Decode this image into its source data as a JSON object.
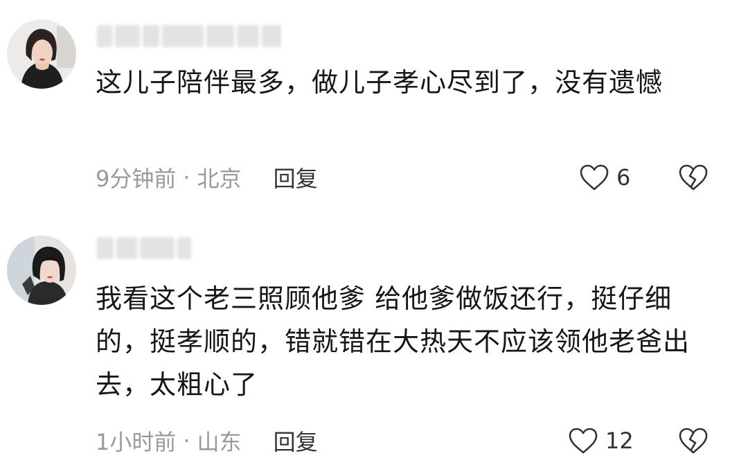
{
  "comments": [
    {
      "text": "这儿子陪伴最多，做儿子孝心尽到了，没有遗憾",
      "time": "9分钟前",
      "separator": "·",
      "location": "北京",
      "reply_label": "回复",
      "likes": "6",
      "icons": {
        "like": "heart-outline-icon",
        "dislike": "broken-heart-icon"
      }
    },
    {
      "text": "我看这个老三照顾他爹 给他爹做饭还行，挺仔细的，挺孝顺的，错就错在大热天不应该领他老爸出去，太粗心了",
      "time": "1小时前",
      "separator": "·",
      "location": "山东",
      "reply_label": "回复",
      "likes": "12",
      "icons": {
        "like": "heart-outline-icon",
        "dislike": "broken-heart-icon"
      }
    }
  ],
  "colors": {
    "background": "#ffffff",
    "text": "#161616",
    "meta": "#9a9a9a",
    "icon": "#333333"
  }
}
